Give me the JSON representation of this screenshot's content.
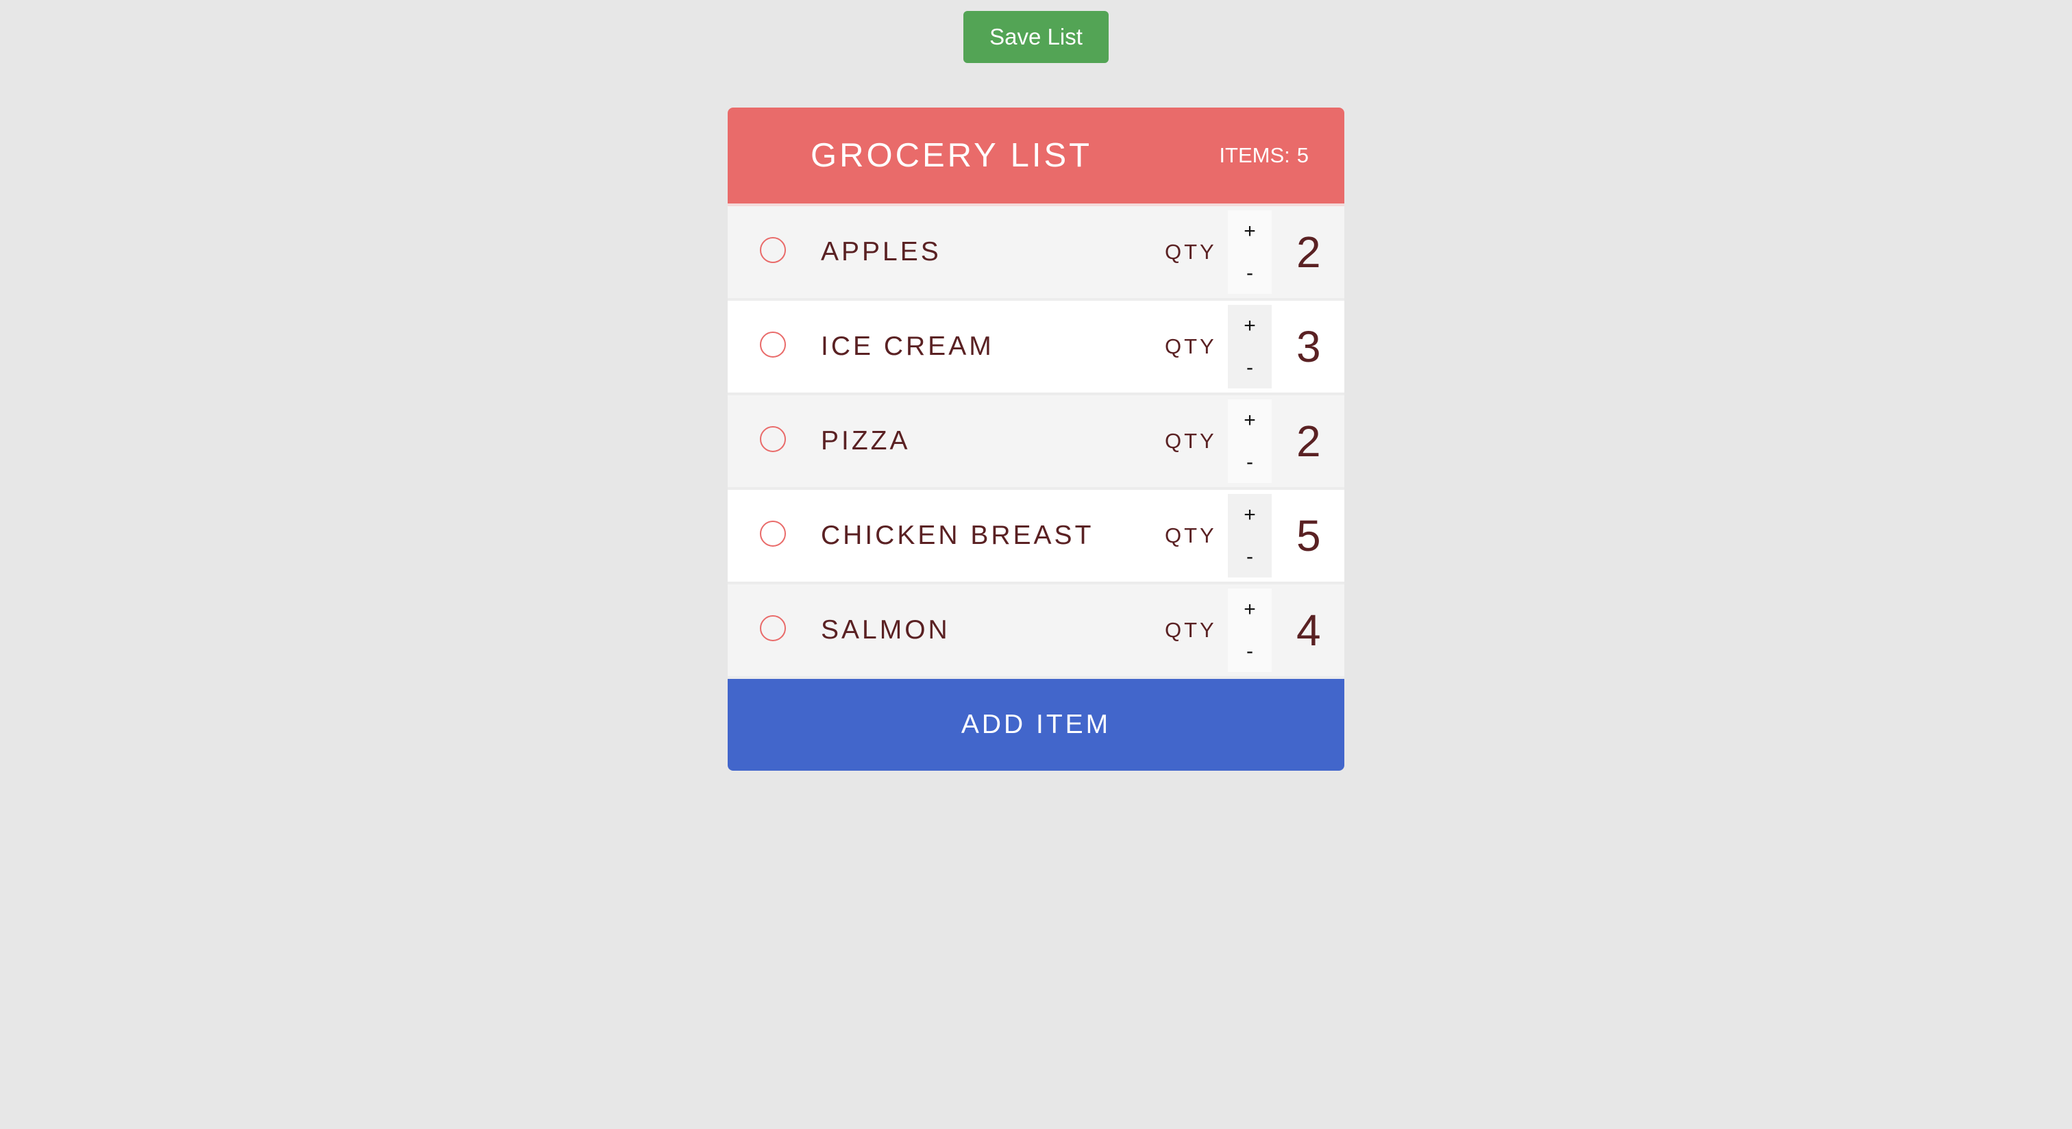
{
  "toolbar": {
    "save_label": "Save List"
  },
  "header": {
    "title": "GROCERY LIST",
    "count_label": "ITEMS:",
    "count_value": "5"
  },
  "items": [
    {
      "name": "APPLES",
      "qty_label": "QTY",
      "plus": "+",
      "minus": "-",
      "qty": "2"
    },
    {
      "name": "ICE CREAM",
      "qty_label": "QTY",
      "plus": "+",
      "minus": "-",
      "qty": "3"
    },
    {
      "name": "PIZZA",
      "qty_label": "QTY",
      "plus": "+",
      "minus": "-",
      "qty": "2"
    },
    {
      "name": "CHICKEN BREAST",
      "qty_label": "QTY",
      "plus": "+",
      "minus": "-",
      "qty": "5"
    },
    {
      "name": "SALMON",
      "qty_label": "QTY",
      "plus": "+",
      "minus": "-",
      "qty": "4"
    }
  ],
  "footer": {
    "add_label": "ADD ITEM"
  },
  "colors": {
    "header": "#e96b6a",
    "save_button": "#53a455",
    "add_button": "#4266cb",
    "item_text": "#5a2123",
    "background": "#e7e7e7"
  }
}
